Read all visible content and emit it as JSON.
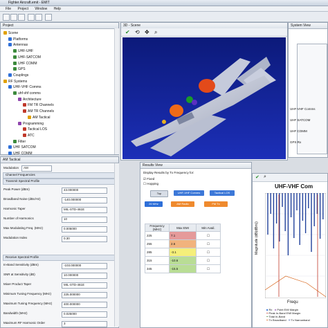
{
  "window": {
    "title": "Fighter Aircraft.emit - EMIT"
  },
  "menu": [
    "File",
    "Project",
    "Window",
    "Help"
  ],
  "project_panel": {
    "title": "Project",
    "tree": [
      {
        "label": "Scene",
        "depth": 0
      },
      {
        "label": "Platforms",
        "depth": 1
      },
      {
        "label": "Antennas",
        "depth": 1
      },
      {
        "label": "UHF-UHF",
        "depth": 2
      },
      {
        "label": "UHF-SATCOM",
        "depth": 2
      },
      {
        "label": "UHF COMM",
        "depth": 2
      },
      {
        "label": "GPS",
        "depth": 2
      },
      {
        "label": "Couplings",
        "depth": 1
      },
      {
        "label": "RF Systems",
        "depth": 0
      },
      {
        "label": "UHF-VHF Comms",
        "depth": 1
      },
      {
        "label": "uhf-vhf comms",
        "depth": 2
      },
      {
        "label": "Architecture",
        "depth": 3
      },
      {
        "label": "FM TR Channels",
        "depth": 4
      },
      {
        "label": "AM TR Channels",
        "depth": 4
      },
      {
        "label": "AM Tactical",
        "depth": 5
      },
      {
        "label": "Programming",
        "depth": 3
      },
      {
        "label": "Tactical LOS",
        "depth": 4
      },
      {
        "label": "ATC",
        "depth": 4
      },
      {
        "label": "Filter",
        "depth": 2
      },
      {
        "label": "UHF SATCOM",
        "depth": 1
      },
      {
        "label": "UHF COMM",
        "depth": 1
      }
    ]
  },
  "am_panel": {
    "title": "AM Tactical",
    "modulation_label": "Modulation",
    "modulation_value": "AM",
    "sec_channel": "Channel Frequencies",
    "sec_transmit": "Transmit Spectral Profile",
    "transmit_fields": [
      {
        "label": "Peak Power (dBm)",
        "value": "43.000000"
      },
      {
        "label": "Broadband Noise (dBc/Hz)",
        "value": "-140.000000"
      },
      {
        "label": "Harmonic Taper",
        "value": "MIL-STD-461E"
      },
      {
        "label": "Number of Harmonics",
        "value": "10"
      },
      {
        "label": "Max Modulating Freq. (MHz)",
        "value": "0.005000"
      },
      {
        "label": "Modulation Index",
        "value": "0.30"
      }
    ],
    "sec_receive": "Receive Spectral Profile",
    "receive_fields": [
      {
        "label": "In-Band Sensitivity (dBm)",
        "value": "-103.000000"
      },
      {
        "label": "SNR at Sensitivity (dB)",
        "value": "10.000000"
      },
      {
        "label": "Mixer Product Taper",
        "value": "MIL-STD-461E"
      },
      {
        "label": "Minimum Tuning Frequency (MHz)",
        "value": "225.000000"
      },
      {
        "label": "Maximum Tuning Frequency (MHz)",
        "value": "400.000000"
      },
      {
        "label": "Bandwidth (MHz)",
        "value": "0.025000"
      },
      {
        "label": "Maximum RF Harmonic Order",
        "value": "3"
      }
    ]
  },
  "scene_panel": {
    "title": "3D - Scene"
  },
  "system_panel": {
    "title": "System View",
    "items": [
      "UHF-VHF Comms",
      "UHF SATCOM",
      "UHF COMM",
      "GPS Rx"
    ]
  },
  "results_panel": {
    "title": "Results View",
    "display_label": "Display Results by Tx Frequency for:",
    "radio1": "Fixed",
    "radio2": "Hopping",
    "top_btn": "Top",
    "path": [
      "UHF-VHF Comms",
      "Tactical LOS"
    ],
    "tx_chip": "26 MHz",
    "tx_chip2": "AM Radio",
    "tx_chip3": "FM Tx",
    "table_headers": [
      "Frequency (MHz)",
      "Max EMI",
      "Min Avail."
    ],
    "rows": [
      {
        "freq": "225",
        "emi": "7.1"
      },
      {
        "freq": "255",
        "emi": "2.6"
      },
      {
        "freq": "285",
        "emi": "-3.1"
      },
      {
        "freq": "315",
        "emi": "-10.6"
      },
      {
        "freq": "345",
        "emi": "-15.5"
      }
    ]
  },
  "chart_panel": {
    "title": "UHF-VHF Com",
    "ylabel": "Magnitude (dB(dBm))",
    "xlabel": "Frequ",
    "legend": [
      "Rx",
      "Point EMI Margin",
      "Peak In-Band EMI Margin",
      "Total In-Band",
      "Tx Broadband",
      "Tx Narrowband"
    ]
  },
  "colors": {
    "emi_red": "#e59a9a",
    "emi_orange": "#f1b37d",
    "emi_yellow": "#f5ef7a",
    "emi_green": "#b9dd95",
    "accent": "#2e6fd8"
  }
}
